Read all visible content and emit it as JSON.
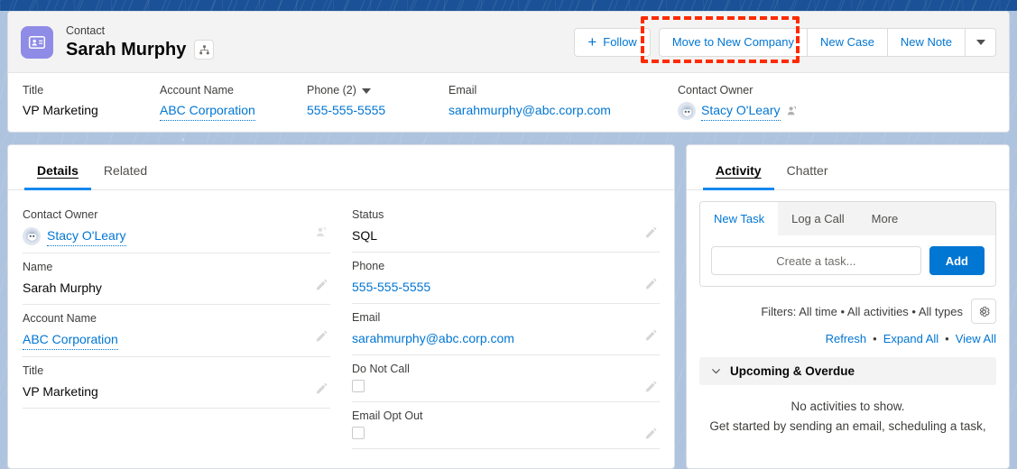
{
  "highlights": {
    "object_label": "Contact",
    "record_name": "Sarah Murphy",
    "avatar_icon": "contact-card-icon",
    "hierarchy_icon": "hierarchy-icon",
    "follow_label": "Follow",
    "actions": [
      {
        "label": "Move to New Company",
        "highlighted": true
      },
      {
        "label": "New Case",
        "highlighted": false
      },
      {
        "label": "New Note",
        "highlighted": false
      }
    ],
    "more_actions_icon": "chevron-down-icon",
    "fields": [
      {
        "label": "Title",
        "value": "VP Marketing",
        "link": false
      },
      {
        "label": "Account Name",
        "value": "ABC Corporation",
        "link": true
      },
      {
        "label": "Phone (2)",
        "value": "555-555-5555",
        "link": true,
        "has_caret": true
      },
      {
        "label": "Email",
        "value": "sarahmurphy@abc.corp.com",
        "link": true
      },
      {
        "label": "Contact Owner",
        "value": "Stacy O'Leary",
        "link": true,
        "has_avatar": true,
        "has_change_owner": true
      }
    ]
  },
  "details_card": {
    "tabs": [
      {
        "label": "Details",
        "active": true
      },
      {
        "label": "Related",
        "active": false
      }
    ],
    "left_fields": [
      {
        "label": "Contact Owner",
        "value": "Stacy O'Leary",
        "type": "link-avatar",
        "action_icon": "change-owner-icon"
      },
      {
        "label": "Name",
        "value": "Sarah Murphy",
        "type": "text",
        "action_icon": "pencil-icon"
      },
      {
        "label": "Account Name",
        "value": "ABC Corporation",
        "type": "link",
        "action_icon": "pencil-icon"
      },
      {
        "label": "Title",
        "value": "VP Marketing",
        "type": "text",
        "action_icon": "pencil-icon"
      }
    ],
    "right_fields": [
      {
        "label": "Status",
        "value": "SQL",
        "type": "text",
        "action_icon": "pencil-icon"
      },
      {
        "label": "Phone",
        "value": "555-555-5555",
        "type": "link",
        "action_icon": "pencil-icon"
      },
      {
        "label": "Email",
        "value": "sarahmurphy@abc.corp.com",
        "type": "link",
        "action_icon": "pencil-icon"
      },
      {
        "label": "Do Not Call",
        "value": "",
        "type": "checkbox",
        "checked": false,
        "action_icon": "pencil-icon"
      },
      {
        "label": "Email Opt Out",
        "value": "",
        "type": "checkbox",
        "checked": false,
        "action_icon": "pencil-icon"
      }
    ]
  },
  "activity_card": {
    "tabs": [
      {
        "label": "Activity",
        "active": true
      },
      {
        "label": "Chatter",
        "active": false
      }
    ],
    "composer": {
      "tabs": [
        {
          "label": "New Task",
          "active": true
        },
        {
          "label": "Log a Call",
          "active": false
        },
        {
          "label": "More",
          "active": false
        }
      ],
      "input_placeholder": "Create a task...",
      "input_value": "",
      "add_label": "Add"
    },
    "filters_text": "Filters: All time • All activities • All types",
    "filter_settings_icon": "gear-icon",
    "links": [
      {
        "label": "Refresh"
      },
      {
        "label": "Expand All"
      },
      {
        "label": "View All"
      }
    ],
    "link_separator": "•",
    "section": {
      "toggle_icon": "chevron-down-icon",
      "title": "Upcoming & Overdue",
      "empty_title": "No activities to show.",
      "empty_subtitle": "Get started by sending an email, scheduling a task,"
    }
  },
  "colors": {
    "brand_blue": "#0176d3",
    "link_blue": "#1589ee",
    "highlight_red": "#ff2a00",
    "avatar_purple": "#8f8ce7",
    "banner_blue": "#1b5297"
  }
}
